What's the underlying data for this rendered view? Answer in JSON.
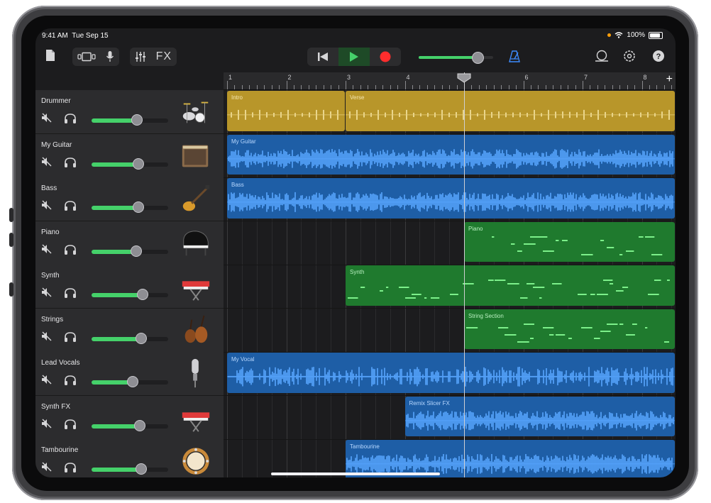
{
  "status": {
    "time": "9:41 AM",
    "date": "Tue Sep 15",
    "battery": "100%"
  },
  "toolbar": {
    "fx_label": "FX"
  },
  "ruler": {
    "bars": [
      "1",
      "2",
      "3",
      "4",
      "5",
      "6",
      "7",
      "8"
    ]
  },
  "colors": {
    "drummer": "#b8962a",
    "audio": "#1e5ea6",
    "midi": "#1f7a2e",
    "meter": "#45d16a"
  },
  "tracks": [
    {
      "name": "Drummer",
      "volume": 0.58,
      "icon": "drum-kit-icon"
    },
    {
      "name": "My Guitar",
      "volume": 0.6,
      "icon": "guitar-amp-icon"
    },
    {
      "name": "Bass",
      "volume": 0.6,
      "icon": "bass-guitar-icon"
    },
    {
      "name": "Piano",
      "volume": 0.57,
      "icon": "grand-piano-icon"
    },
    {
      "name": "Synth",
      "volume": 0.66,
      "icon": "synth-keyboard-icon"
    },
    {
      "name": "Strings",
      "volume": 0.64,
      "icon": "cello-icon"
    },
    {
      "name": "Lead Vocals",
      "volume": 0.53,
      "icon": "microphone-icon"
    },
    {
      "name": "Synth FX",
      "volume": 0.62,
      "icon": "synth-keyboard-icon"
    },
    {
      "name": "Tambourine",
      "volume": 0.64,
      "icon": "tambourine-icon"
    }
  ],
  "regions": [
    {
      "track": 0,
      "label": "Intro",
      "start": 1,
      "end": 3,
      "kind": "drummer"
    },
    {
      "track": 0,
      "label": "Verse",
      "start": 3,
      "end": 8.6,
      "kind": "drummer"
    },
    {
      "track": 1,
      "label": "My Guitar",
      "start": 1,
      "end": 8.6,
      "kind": "audio"
    },
    {
      "track": 2,
      "label": "Bass",
      "start": 1,
      "end": 8.6,
      "kind": "audio"
    },
    {
      "track": 3,
      "label": "Piano",
      "start": 5,
      "end": 8.6,
      "kind": "midi"
    },
    {
      "track": 4,
      "label": "Synth",
      "start": 3,
      "end": 8.6,
      "kind": "midi"
    },
    {
      "track": 5,
      "label": "String Section",
      "start": 5,
      "end": 8.6,
      "kind": "midi"
    },
    {
      "track": 6,
      "label": "My Vocal",
      "start": 1,
      "end": 8.6,
      "kind": "audio"
    },
    {
      "track": 7,
      "label": "Remix Slicer FX",
      "start": 4,
      "end": 8.6,
      "kind": "audio"
    },
    {
      "track": 8,
      "label": "Tambourine",
      "start": 3,
      "end": 8.6,
      "kind": "audio"
    }
  ],
  "playhead_bar": 5
}
